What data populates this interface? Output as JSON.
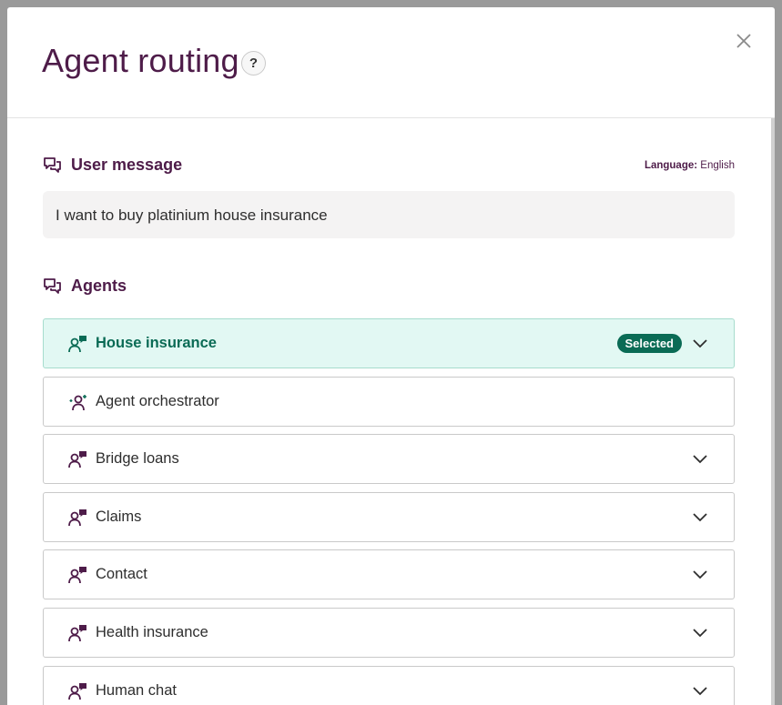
{
  "dialog": {
    "title": "Agent routing",
    "help_glyph": "?",
    "close_icon": "close-icon"
  },
  "user_message": {
    "heading": "User message",
    "language_label": "Language:",
    "language_value": "English",
    "text": "I want to buy platinium house insurance"
  },
  "agents": {
    "heading": "Agents",
    "selected_badge": "Selected",
    "items": [
      {
        "label": "House insurance",
        "icon": "agent-chat-icon",
        "selected": true
      },
      {
        "label": "Agent orchestrator",
        "icon": "orchestrator-icon",
        "selected": false
      },
      {
        "label": "Bridge loans",
        "icon": "agent-chat-icon",
        "selected": false
      },
      {
        "label": "Claims",
        "icon": "agent-chat-icon",
        "selected": false
      },
      {
        "label": "Contact",
        "icon": "agent-chat-icon",
        "selected": false
      },
      {
        "label": "Health insurance",
        "icon": "agent-chat-icon",
        "selected": false
      },
      {
        "label": "Human chat",
        "icon": "agent-chat-icon",
        "selected": false
      }
    ]
  },
  "colors": {
    "brand": "#4e1c49",
    "selected_accent": "#0a6b55",
    "selected_bg": "#e2f8f3"
  }
}
